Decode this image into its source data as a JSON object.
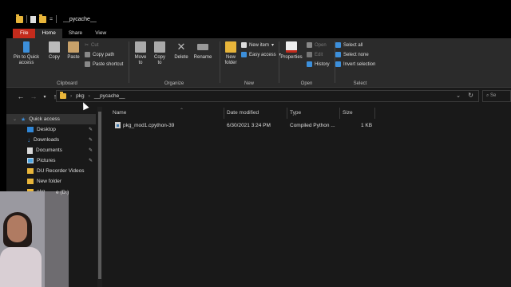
{
  "window": {
    "title": "__pycache__",
    "quick_access_toolbar": [
      "folder-icon",
      "doc-icon",
      "folder-icon"
    ],
    "qa_dropdown": "="
  },
  "ribbon": {
    "tabs": [
      {
        "label": "File"
      },
      {
        "label": "Home"
      },
      {
        "label": "Share"
      },
      {
        "label": "View"
      }
    ],
    "clipboard": {
      "label": "Clipboard",
      "pin": "Pin to Quick access",
      "copy": "Copy",
      "paste": "Paste",
      "cut": "Cut",
      "copy_path": "Copy path",
      "paste_shortcut": "Paste shortcut"
    },
    "organize": {
      "label": "Organize",
      "move_to": "Move to",
      "copy_to": "Copy to",
      "delete": "Delete",
      "rename": "Rename"
    },
    "new": {
      "label": "New",
      "new_folder": "New folder",
      "new_item": "New item",
      "easy_access": "Easy access"
    },
    "open": {
      "label": "Open",
      "properties": "Properties",
      "open": "Open",
      "edit": "Edit",
      "history": "History"
    },
    "select": {
      "label": "Select",
      "select_all": "Select all",
      "select_none": "Select none",
      "invert": "Invert selection"
    }
  },
  "address": {
    "crumbs": [
      "pkg",
      "__pycache__"
    ],
    "search_placeholder": "Se"
  },
  "nav": {
    "items": [
      {
        "label": "Quick access",
        "icon": "star-icon"
      },
      {
        "label": "Desktop",
        "icon": "desktop-icon"
      },
      {
        "label": "Downloads",
        "icon": "download-icon"
      },
      {
        "label": "Documents",
        "icon": "document-icon"
      },
      {
        "label": "Pictures",
        "icon": "pictures-icon"
      },
      {
        "label": "DU Recorder Videos",
        "icon": "folder-icon"
      },
      {
        "label": "New folder",
        "icon": "folder-icon"
      },
      {
        "label": "pkg",
        "icon": "folder-icon"
      }
    ],
    "partial_drive": "e (D:)"
  },
  "columns": {
    "name": "Name",
    "date": "Date modified",
    "type": "Type",
    "size": "Size"
  },
  "files": [
    {
      "name": "pkg_mod1.cpython-39",
      "date": "6/30/2021 3:24 PM",
      "type": "Compiled Python ...",
      "size": "1 KB"
    }
  ],
  "colors": {
    "file_tab": "#c42b1c",
    "background": "#191919",
    "ribbon": "#2b2b2b",
    "folder": "#e8b53a",
    "accent": "#3c8fdb"
  }
}
